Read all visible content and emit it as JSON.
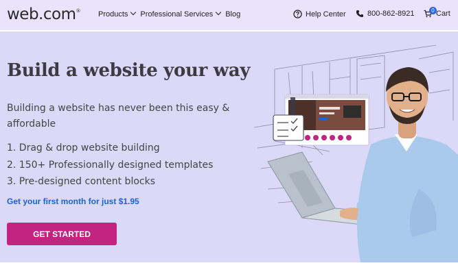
{
  "logo": {
    "text": "web.com",
    "mark": "®"
  },
  "nav": {
    "products": "Products",
    "services": "Professional Services",
    "blog": "Blog",
    "help": "Help Center",
    "phone": "800-862-8921",
    "cart": "Cart",
    "cart_count": "0"
  },
  "hero": {
    "title": "Build a website your way",
    "subtitle": "Building a website has never been this easy & affordable",
    "features": [
      "1. Drag & drop website building",
      "2. 150+ Professionally designed templates",
      "3. Pre-designed content blocks"
    ],
    "offer": "Get your first month for just $1.95",
    "cta": "GET STARTED"
  },
  "colors": {
    "nav_bg": "#e9e4fb",
    "hero_bg": "#dcd8f7",
    "cta": "#c2247f",
    "offer": "#1b63d6",
    "badge": "#2b66e0"
  }
}
